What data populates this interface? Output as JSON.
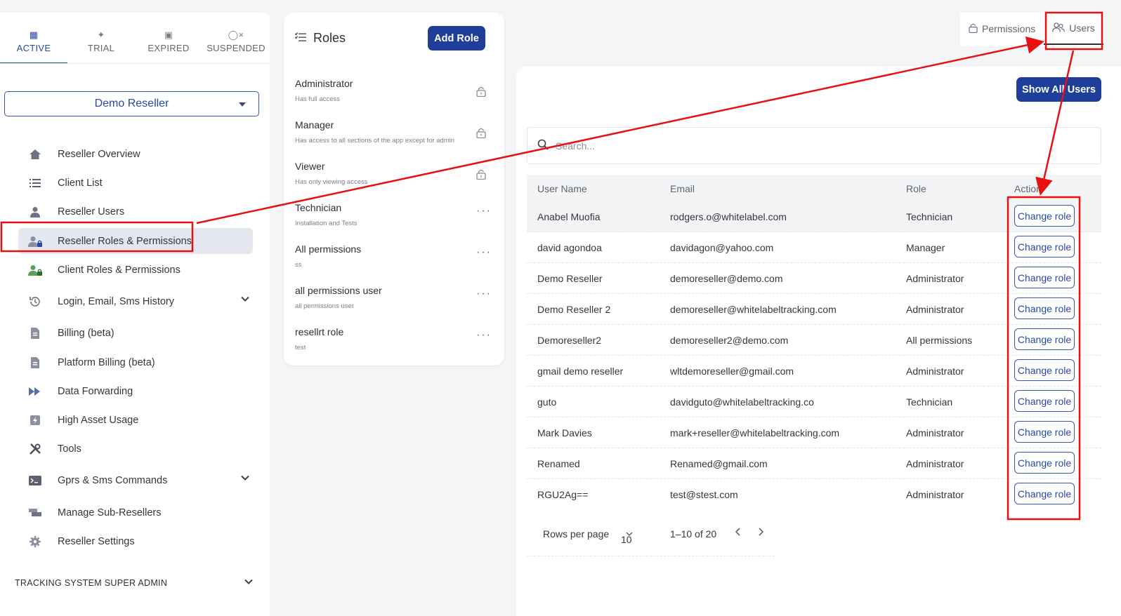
{
  "sidebar": {
    "status_tabs": [
      {
        "label": "ACTIVE",
        "icon": "calendar-icon"
      },
      {
        "label": "TRIAL",
        "icon": "party-icon"
      },
      {
        "label": "EXPIRED",
        "icon": "calendar-x-icon"
      },
      {
        "label": "SUSPENDED",
        "icon": "user-x-icon"
      }
    ],
    "reseller_select": "Demo Reseller",
    "items": [
      {
        "label": "Reseller Overview",
        "icon": "home-icon"
      },
      {
        "label": "Client List",
        "icon": "list-icon"
      },
      {
        "label": "Reseller Users",
        "icon": "user-icon"
      },
      {
        "label": "Reseller Roles & Permissions",
        "icon": "user-lock-icon"
      },
      {
        "label": "Client Roles & Permissions",
        "icon": "users-lock-icon"
      },
      {
        "label": "Login, Email, Sms History",
        "icon": "history-icon"
      },
      {
        "label": "Billing (beta)",
        "icon": "document-icon"
      },
      {
        "label": "Platform Billing (beta)",
        "icon": "document-icon"
      },
      {
        "label": "Data Forwarding",
        "icon": "forward-icon"
      },
      {
        "label": "High Asset Usage",
        "icon": "bolt-icon"
      },
      {
        "label": "Tools",
        "icon": "tools-icon"
      },
      {
        "label": "Gprs & Sms Commands",
        "icon": "terminal-icon"
      },
      {
        "label": "Manage Sub-Resellers",
        "icon": "stack-icon"
      },
      {
        "label": "Reseller Settings",
        "icon": "gear-icon"
      }
    ],
    "section": "TRACKING SYSTEM SUPER ADMIN"
  },
  "roles": {
    "title": "Roles",
    "add_label": "Add Role",
    "list": [
      {
        "name": "Administrator",
        "desc": "Has full access"
      },
      {
        "name": "Manager",
        "desc": "Has access to all sections of the app except for admin"
      },
      {
        "name": "Viewer",
        "desc": "Has only viewing access"
      },
      {
        "name": "Technician",
        "desc": "Installation and Tests"
      },
      {
        "name": "All permissions",
        "desc": "ss"
      },
      {
        "name": "all permissions user",
        "desc": "all permissions user"
      },
      {
        "name": "resellrt role",
        "desc": "test"
      }
    ],
    "more_glyph": "···",
    "lock_glyph": "🔒"
  },
  "top_tabs": {
    "permissions": "Permissions",
    "users": "Users"
  },
  "users": {
    "show_all_label": "Show All Users",
    "search_placeholder": "Search...",
    "columns": [
      "User Name",
      "Email",
      "Role",
      "Action"
    ],
    "action_label": "Change role",
    "rows": [
      {
        "name": "Anabel Muofia",
        "email": "rodgers.o@whitelabel.com",
        "role": "Technician"
      },
      {
        "name": "david agondoa",
        "email": "davidagon@yahoo.com",
        "role": "Manager"
      },
      {
        "name": "Demo Reseller",
        "email": "demoreseller@demo.com",
        "role": "Administrator"
      },
      {
        "name": "Demo Reseller 2",
        "email": "demoreseller@whitelabeltracking.com",
        "role": "Administrator"
      },
      {
        "name": "Demoreseller2",
        "email": "demoreseller2@demo.com",
        "role": "All permissions"
      },
      {
        "name": "gmail demo reseller",
        "email": "wltdemoreseller@gmail.com",
        "role": "Administrator"
      },
      {
        "name": "guto",
        "email": "davidguto@whitelabeltracking.co",
        "role": "Technician"
      },
      {
        "name": "Mark Davies",
        "email": "mark+reseller@whitelabeltracking.com",
        "role": "Administrator"
      },
      {
        "name": "Renamed",
        "email": "Renamed@gmail.com",
        "role": "Administrator"
      },
      {
        "name": "RGU2Ag==",
        "email": "test@stest.com",
        "role": "Administrator"
      }
    ],
    "pagination": {
      "rows_per_page_label": "Rows per page",
      "rows_per_page": "10",
      "range": "1–10 of 20"
    }
  },
  "accent_color": "#1f3e99",
  "annotation_color": "#e81010"
}
